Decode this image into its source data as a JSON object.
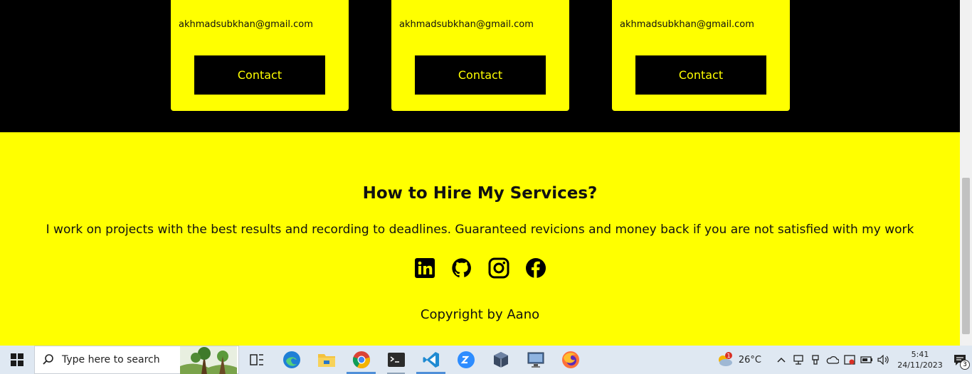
{
  "cards": [
    {
      "email": "akhmadsubkhan@gmail.com",
      "button": "Contact"
    },
    {
      "email": "akhmadsubkhan@gmail.com",
      "button": "Contact"
    },
    {
      "email": "akhmadsubkhan@gmail.com",
      "button": "Contact"
    }
  ],
  "hire": {
    "title": "How to Hire My Services?",
    "text": "I work on projects with the best results and recording to deadlines. Guaranteed revicions and money back if you are not satisfied with my work",
    "social_icons": [
      "linkedin-icon",
      "github-icon",
      "instagram-icon",
      "facebook-icon"
    ],
    "copyright": "Copyright by Aano"
  },
  "colors": {
    "accent": "#ffff00",
    "dark": "#000000"
  },
  "taskbar": {
    "search_placeholder": "Type here to search",
    "apps": [
      "task-view",
      "edge",
      "file-explorer",
      "chrome",
      "terminal",
      "vscode",
      "zoom",
      "virtualbox",
      "remote-desktop",
      "firefox"
    ],
    "weather": {
      "temp": "26°C",
      "badge": "1"
    },
    "time": "5:41",
    "date": "24/11/2023",
    "notifications": "3"
  }
}
